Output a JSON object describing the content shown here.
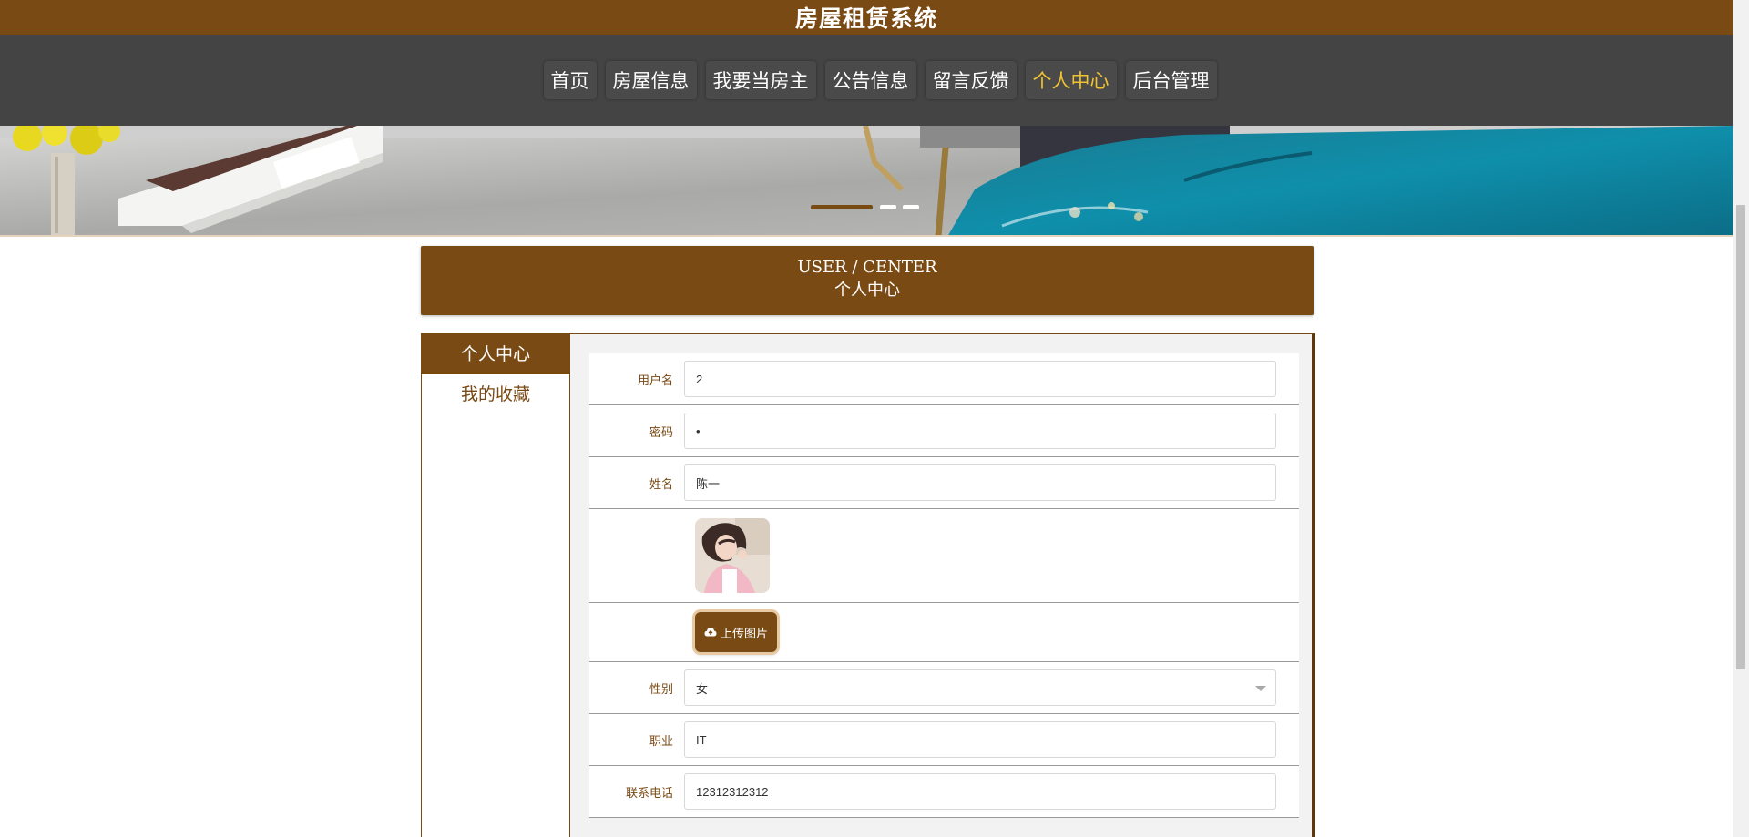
{
  "app": {
    "title": "房屋租赁系统"
  },
  "nav": {
    "items": [
      {
        "label": "首页",
        "active": false
      },
      {
        "label": "房屋信息",
        "active": false
      },
      {
        "label": "我要当房主",
        "active": false
      },
      {
        "label": "公告信息",
        "active": false
      },
      {
        "label": "留言反馈",
        "active": false
      },
      {
        "label": "个人中心",
        "active": true
      },
      {
        "label": "后台管理",
        "active": false
      }
    ]
  },
  "banner": {
    "slides_total": 3,
    "active_slide": 1
  },
  "section": {
    "title_en": "USER / CENTER",
    "title_cn": "个人中心"
  },
  "sidebar": {
    "items": [
      {
        "label": "个人中心",
        "active": true
      },
      {
        "label": "我的收藏",
        "active": false
      }
    ]
  },
  "form": {
    "username": {
      "label": "用户名",
      "value": "2"
    },
    "password": {
      "label": "密码",
      "value": "•"
    },
    "name": {
      "label": "姓名",
      "value": "陈一"
    },
    "upload_label": "上传图片",
    "gender": {
      "label": "性别",
      "value": "女"
    },
    "job": {
      "label": "职业",
      "value": "IT"
    },
    "phone": {
      "label": "联系电话",
      "value": "12312312312"
    }
  },
  "colors": {
    "brand": "#7a4a14",
    "nav_bg": "#444444",
    "nav_active": "#f2c230"
  }
}
